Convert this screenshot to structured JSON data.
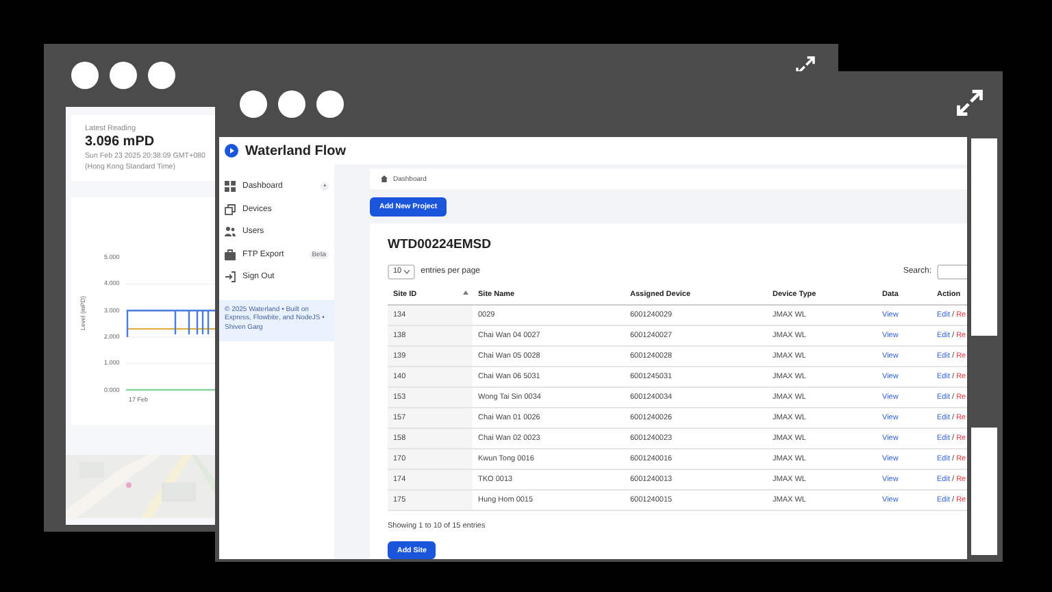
{
  "back_window": {
    "latest": {
      "label": "Latest Reading",
      "value": "3.096 mPD",
      "time": "Sun Feb 23 2025 20:38:09 GMT+080",
      "zone": "(Hong Kong Standard Time)"
    },
    "chart": {
      "ylabel": "Level (mPD)",
      "y_ticks": [
        "5.000",
        "4.000",
        "3.000",
        "2.000",
        "1.000",
        "0.000"
      ],
      "x_ticks": [
        "17 Feb"
      ]
    }
  },
  "front_window": {
    "brand": "Waterland Flow",
    "sidebar": {
      "items": [
        {
          "label": "Dashboard",
          "badge": "•"
        },
        {
          "label": "Devices"
        },
        {
          "label": "Users"
        },
        {
          "label": "FTP Export",
          "badge": "Beta"
        },
        {
          "label": "Sign Out"
        }
      ],
      "footer": "© 2025 Waterland • Built on Express, Flowbite, and NodeJS • Shiven Garg"
    },
    "breadcrumb": "Dashboard",
    "add_project_button": "Add New Project",
    "project_title": "WTD00224EMSD",
    "page_size": {
      "value": "10",
      "label": "entries per page"
    },
    "search": {
      "label": "Search:"
    },
    "table": {
      "columns": [
        "Site ID",
        "Site Name",
        "Assigned Device",
        "Device Type",
        "Data",
        "Action"
      ],
      "rows": [
        {
          "site_id": "134",
          "site_name": "0029",
          "device": "6001240029",
          "type": "JMAX WL",
          "data": "View",
          "edit": "Edit",
          "sep": "/",
          "remove": "Re"
        },
        {
          "site_id": "138",
          "site_name": "Chai Wan 04 0027",
          "device": "6001240027",
          "type": "JMAX WL",
          "data": "View",
          "edit": "Edit",
          "sep": "/",
          "remove": "Re"
        },
        {
          "site_id": "139",
          "site_name": "Chai Wan 05 0028",
          "device": "6001240028",
          "type": "JMAX WL",
          "data": "View",
          "edit": "Edit",
          "sep": "/",
          "remove": "Re"
        },
        {
          "site_id": "140",
          "site_name": "Chai Wan 06 5031",
          "device": "6001245031",
          "type": "JMAX WL",
          "data": "View",
          "edit": "Edit",
          "sep": "/",
          "remove": "Re"
        },
        {
          "site_id": "153",
          "site_name": "Wong Tai Sin 0034",
          "device": "6001240034",
          "type": "JMAX WL",
          "data": "View",
          "edit": "Edit",
          "sep": "/",
          "remove": "Re"
        },
        {
          "site_id": "157",
          "site_name": "Chai Wan 01 0026",
          "device": "6001240026",
          "type": "JMAX WL",
          "data": "View",
          "edit": "Edit",
          "sep": "/",
          "remove": "Re"
        },
        {
          "site_id": "158",
          "site_name": "Chai Wan 02 0023",
          "device": "6001240023",
          "type": "JMAX WL",
          "data": "View",
          "edit": "Edit",
          "sep": "/",
          "remove": "Re"
        },
        {
          "site_id": "170",
          "site_name": "Kwun Tong 0016",
          "device": "6001240016",
          "type": "JMAX WL",
          "data": "View",
          "edit": "Edit",
          "sep": "/",
          "remove": "Re"
        },
        {
          "site_id": "174",
          "site_name": "TKO 0013",
          "device": "6001240013",
          "type": "JMAX WL",
          "data": "View",
          "edit": "Edit",
          "sep": "/",
          "remove": "Re"
        },
        {
          "site_id": "175",
          "site_name": "Hung Hom 0015",
          "device": "6001240015",
          "type": "JMAX WL",
          "data": "View",
          "edit": "Edit",
          "sep": "/",
          "remove": "Re"
        }
      ]
    },
    "summary": "Showing 1 to 10 of 15 entries",
    "add_site_button": "Add Site"
  }
}
